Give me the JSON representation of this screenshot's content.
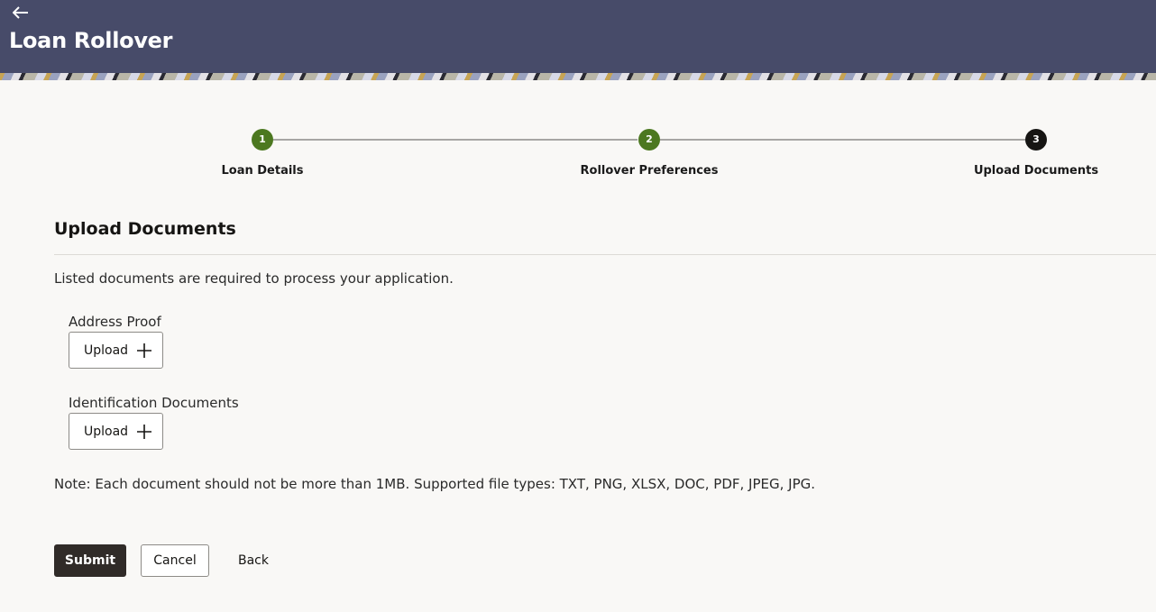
{
  "header": {
    "back_icon": "arrow-left-icon",
    "title": "Loan Rollover"
  },
  "stepper": {
    "steps": [
      {
        "number": "1",
        "label": "Loan Details",
        "status": "done"
      },
      {
        "number": "2",
        "label": "Rollover Preferences",
        "status": "done"
      },
      {
        "number": "3",
        "label": "Upload Documents",
        "status": "current"
      }
    ]
  },
  "main": {
    "section_title": "Upload Documents",
    "intro": "Listed documents are required to process your application.",
    "documents": [
      {
        "label": "Address Proof",
        "button_label": "Upload",
        "button_icon": "plus-icon"
      },
      {
        "label": "Identification Documents",
        "button_label": "Upload",
        "button_icon": "plus-icon"
      }
    ],
    "note": "Note: Each document should not be more than 1MB. Supported file types: TXT, PNG, XLSX, DOC, PDF, JPEG, JPG."
  },
  "actions": {
    "submit_label": "Submit",
    "cancel_label": "Cancel",
    "back_label": "Back"
  },
  "colors": {
    "header_bg": "#474b69",
    "step_done": "#4c7820",
    "step_current": "#161513",
    "primary_button": "#302b28"
  }
}
